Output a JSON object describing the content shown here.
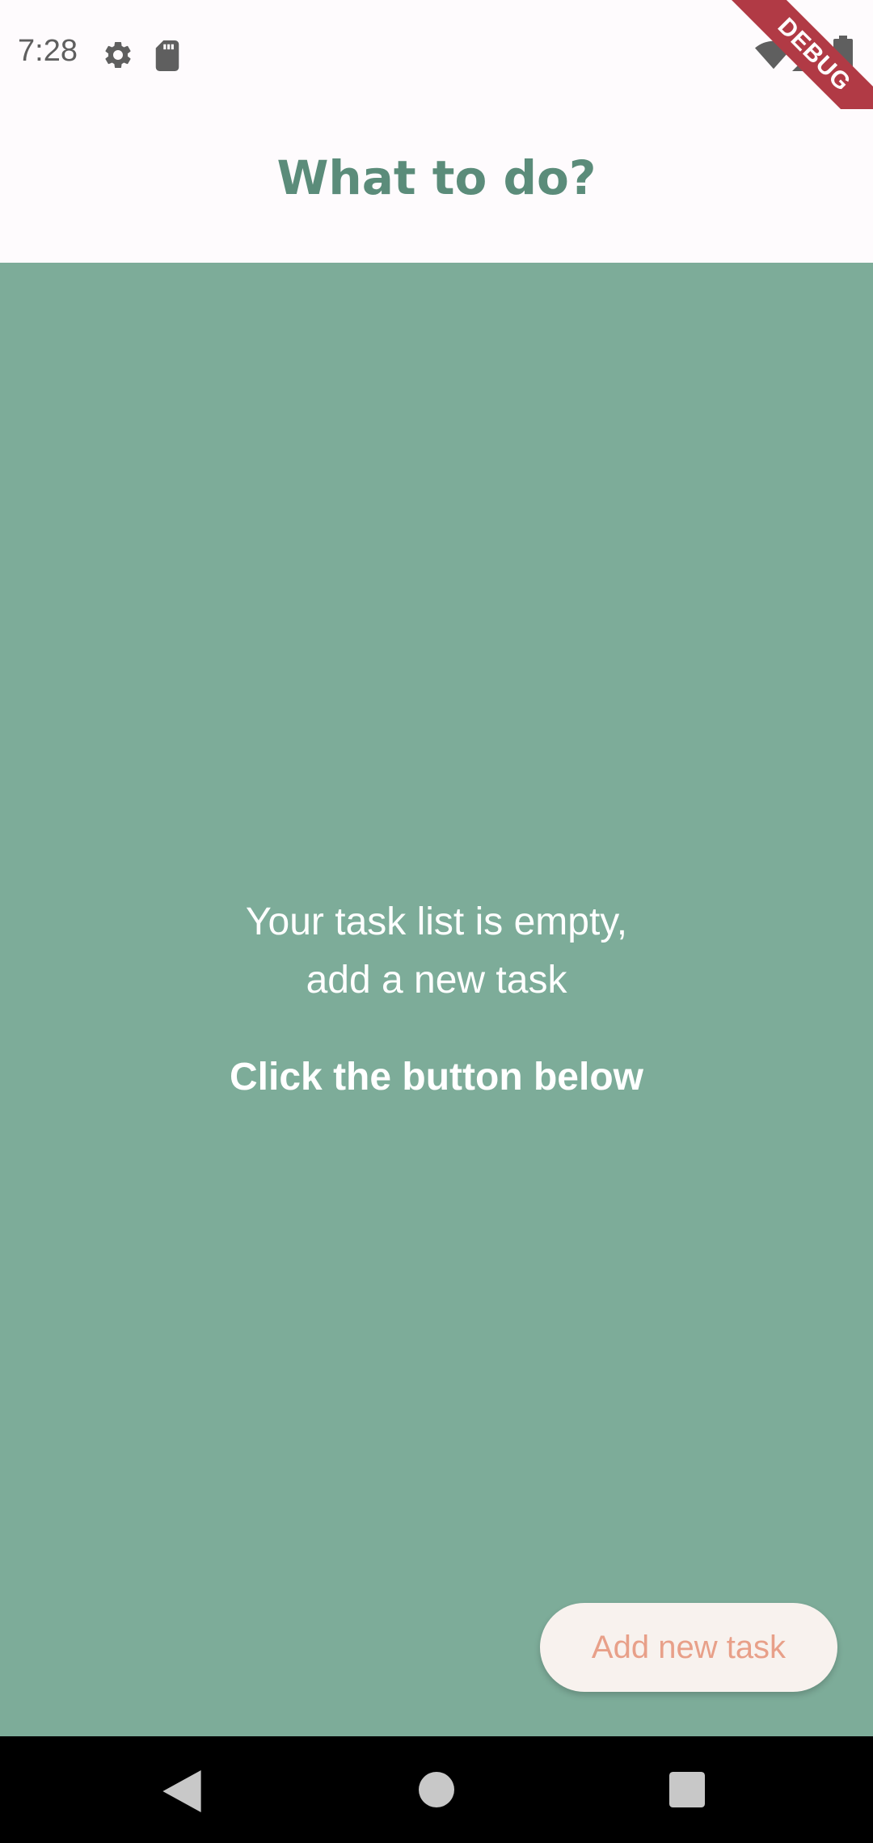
{
  "status_bar": {
    "time": "7:28",
    "icons": [
      "gear-icon",
      "sd-card-icon",
      "wifi-icon",
      "signal-icon",
      "battery-icon"
    ],
    "debug_banner": "DEBUG"
  },
  "app_bar": {
    "title": "What to do?"
  },
  "main": {
    "empty_line1": "Your task list is empty,",
    "empty_line2": "add a new task",
    "cta": "Click the button below"
  },
  "fab": {
    "label": "Add new task"
  },
  "nav_bar": {
    "icons": [
      "back-icon",
      "home-icon",
      "recents-icon"
    ]
  },
  "colors": {
    "primary": "#5b8c7a",
    "background": "#7dac99",
    "button_bg": "#f8f2ee",
    "button_text": "#e8a089",
    "debug_banner": "#b13a45"
  }
}
